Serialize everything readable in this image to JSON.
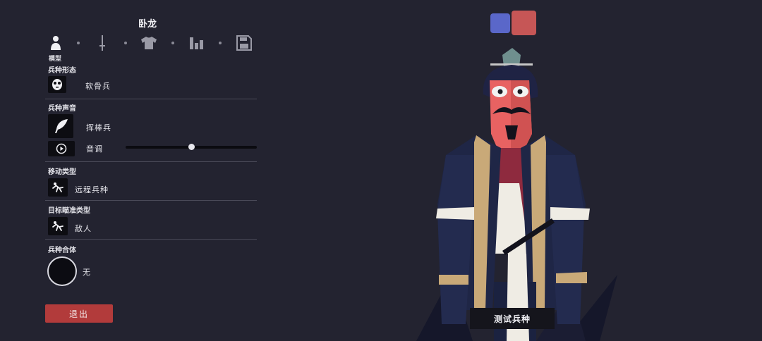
{
  "header": {
    "unit_name": "卧龙"
  },
  "tabs": {
    "items": [
      {
        "icon": "person-icon"
      },
      {
        "icon": "sword-icon"
      },
      {
        "icon": "shirt-icon"
      },
      {
        "icon": "stats-icon"
      },
      {
        "icon": "save-icon"
      }
    ],
    "active_label": "模型"
  },
  "sections": {
    "form": {
      "label": "兵种形态",
      "value": "软骨兵",
      "icon": "mask-face-icon"
    },
    "voice": {
      "label": "兵种声音",
      "value": "挥棒兵",
      "icon": "feather-icon",
      "pitch_label": "音调",
      "pitch_level": 0.5,
      "play_icon": "play-icon"
    },
    "movement": {
      "label": "移动类型",
      "value": "远程兵种",
      "icon": "running-figure-icon"
    },
    "targeting": {
      "label": "目标瞄准类型",
      "value": "敌人",
      "icon": "target-figure-icon"
    },
    "combine": {
      "label": "兵种合体",
      "value": "无"
    }
  },
  "buttons": {
    "exit": "退出",
    "test_unit": "测试兵种"
  },
  "colors": {
    "team_blue": "#5a67c9",
    "team_red": "#c65656",
    "exit_button": "#b23b3b",
    "background": "#232330"
  }
}
